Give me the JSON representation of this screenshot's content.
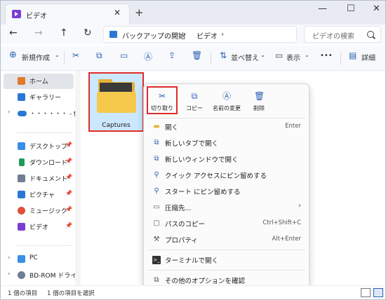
{
  "titlebar": {
    "tab_title": "ビデオ",
    "tab_close": "✕",
    "new_tab": "+",
    "minimize": "—",
    "maximize": "☐",
    "close": "✕"
  },
  "nav": {
    "back": "←",
    "forward": "→",
    "up": "↑",
    "refresh": "↻",
    "breadcrumb": [
      "バックアップの開始",
      "ビデオ"
    ],
    "sep": "›",
    "search_placeholder": "ビデオの検索"
  },
  "toolbar": {
    "new_label": "新規作成",
    "sort_label": "並べ替え",
    "view_label": "表示",
    "more_label": "•••",
    "details_label": "詳細"
  },
  "sidebar": {
    "items": [
      {
        "label": "ホーム",
        "icon": "home-icon",
        "color": "#e07a2b"
      },
      {
        "label": "ギャラリー",
        "icon": "gallery-icon",
        "color": "#2b78d4"
      },
      {
        "label": "・・・・・・ - 個人用",
        "icon": "onedrive-icon",
        "color": "#2b78d4"
      },
      {
        "label": "デスクトップ",
        "icon": "desktop-icon",
        "color": "#3a8ee6"
      },
      {
        "label": "ダウンロード",
        "icon": "download-icon",
        "color": "#1f9a5a"
      },
      {
        "label": "ドキュメント",
        "icon": "document-icon",
        "color": "#6f7f94"
      },
      {
        "label": "ピクチャ",
        "icon": "pictures-icon",
        "color": "#2b78d4"
      },
      {
        "label": "ミュージック",
        "icon": "music-icon",
        "color": "#e0503c"
      },
      {
        "label": "ビデオ",
        "icon": "video-icon",
        "color": "#7a3fd1"
      },
      {
        "label": "PC",
        "icon": "pc-icon",
        "color": "#3a8ee6"
      },
      {
        "label": "BD-ROM ドライブ",
        "icon": "disc-icon",
        "color": "#6f7f94"
      }
    ]
  },
  "content": {
    "folder_name": "Captures"
  },
  "context_menu": {
    "quick_actions": [
      {
        "label": "切り取り",
        "icon": "cut-icon"
      },
      {
        "label": "コピー",
        "icon": "copy-icon"
      },
      {
        "label": "名前の変更",
        "icon": "rename-icon"
      },
      {
        "label": "削除",
        "icon": "delete-icon"
      }
    ],
    "items": [
      {
        "label": "開く",
        "shortcut": "Enter"
      },
      {
        "label": "新しいタブで開く",
        "shortcut": ""
      },
      {
        "label": "新しいウィンドウで開く",
        "shortcut": ""
      },
      {
        "label": "クイック アクセスにピン留めする",
        "shortcut": ""
      },
      {
        "label": "スタート にピン留めする",
        "shortcut": ""
      },
      {
        "label": "圧縮先...",
        "shortcut": ""
      },
      {
        "label": "パスのコピー",
        "shortcut": "Ctrl+Shift+C"
      },
      {
        "label": "プロパティ",
        "shortcut": "Alt+Enter"
      },
      {
        "label": "ターミナルで開く",
        "shortcut": ""
      },
      {
        "label": "その他のオプションを確認",
        "shortcut": ""
      }
    ]
  },
  "status": {
    "count": "1 個の項目",
    "selected": "1 個の項目を選択"
  }
}
